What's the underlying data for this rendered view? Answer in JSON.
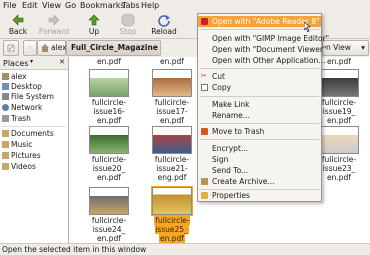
{
  "menubar": {
    "items": [
      "File",
      "Edit",
      "View",
      "Go",
      "Bookmarks",
      "Tabs",
      "Help"
    ]
  },
  "toolbar": {
    "back": "Back",
    "forward": "Forward",
    "up": "Up",
    "stop": "Stop",
    "reload": "Reload"
  },
  "location": {
    "user": "alex",
    "folder": "Full_Circle_Magazine",
    "view_label": "n View"
  },
  "sidebar": {
    "header": "Places",
    "items": [
      "alex",
      "Desktop",
      "File System",
      "Network",
      "Trash",
      "Documents",
      "Music",
      "Pictures",
      "Videos"
    ]
  },
  "files": [
    {
      "name": "fullcircle-issue16-en.pdf",
      "l1": "fullcircle-issue16-",
      "l2": "en.pdf",
      "selected": false
    },
    {
      "name": "fullcircle-issue17-en.pdf",
      "l1": "fullcircle-issue17-",
      "l2": "en.pdf",
      "selected": false
    },
    {
      "name": "fullcircle-issue19-en.pdf",
      "l1": "fullcircle-issue19_",
      "l2": "en.pdf",
      "selected": false
    },
    {
      "name": "fullcircle-issue20-en.pdf",
      "l1": "fullcircle-issue20_",
      "l2": "en.pdf",
      "selected": false
    },
    {
      "name": "fullcircle-issue21-eng.pdf",
      "l1": "fullcircle-issue21-",
      "l2": "eng.pdf",
      "selected": false
    },
    {
      "name": "fullcircle-issue23-en.pdf",
      "l1": "fullcircle-issue23_",
      "l2": "en.pdf",
      "selected": false
    },
    {
      "name": "fullcircle-issue24-en.pdf",
      "l1": "fullcircle-issue24_",
      "l2": "en.pdf",
      "selected": false
    },
    {
      "name": "fullcircle-issue25-en.pdf",
      "l1": "fullcircle-issue25_",
      "l2": "en.pdf",
      "selected": true
    }
  ],
  "top_row": {
    "left": "en.pdf",
    "mid": "en.pdf",
    "right": "en.pdf"
  },
  "context_menu": {
    "open_adobe": "Open with \"Adobe Reader 8\"",
    "open_gimp": "Open with \"GIMP Image Editor\"",
    "open_docviewer": "Open with \"Document Viewer\"",
    "open_other": "Open with Other Application...",
    "cut": "Cut",
    "copy": "Copy",
    "make_link": "Make Link",
    "rename": "Rename...",
    "move_trash": "Move to Trash",
    "encrypt": "Encrypt...",
    "sign": "Sign",
    "send_to": "Send To...",
    "create_archive": "Create Archive...",
    "properties": "Properties"
  },
  "status": "Open the selected item in this window",
  "colors": {
    "highlight": "#f4a23a",
    "window_bg": "#efebe7"
  }
}
